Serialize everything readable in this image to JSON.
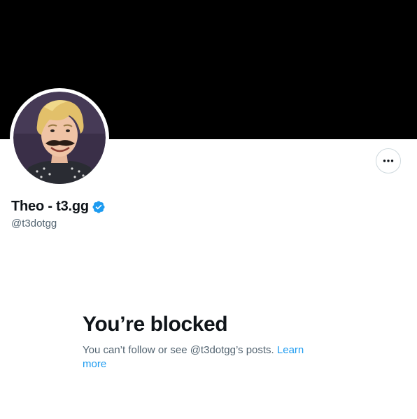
{
  "profile": {
    "display_name": "Theo - t3.gg",
    "handle": "@t3dotgg",
    "verified": true,
    "verified_icon": "verified-badge-icon",
    "avatar_icon": "profile-avatar",
    "banner_color": "#000000"
  },
  "actions": {
    "more_icon": "more-horizontal-icon"
  },
  "blocked": {
    "title": "You’re blocked",
    "message": "You can’t follow or see @t3dotgg’s posts.",
    "learn_more": "Learn more"
  },
  "colors": {
    "accent": "#1d9bf0",
    "text_primary": "#0f1419",
    "text_secondary": "#536471"
  }
}
